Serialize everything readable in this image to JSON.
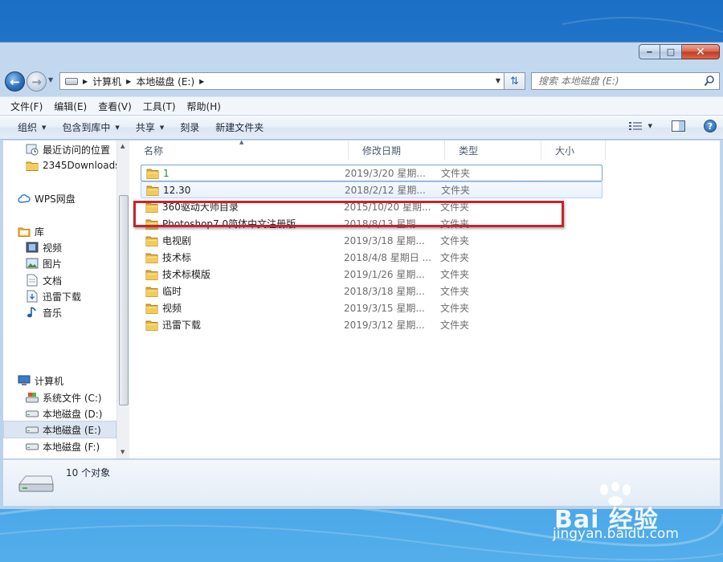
{
  "window": {
    "caption": {
      "minimize": "‒",
      "maximize": "□",
      "close": "✕"
    }
  },
  "address": {
    "crumbs": [
      "计算机",
      "本地磁盘 (E:)"
    ]
  },
  "search": {
    "placeholder": "搜索 本地磁盘 (E:)"
  },
  "menu": [
    "文件(F)",
    "编辑(E)",
    "查看(V)",
    "工具(T)",
    "帮助(H)"
  ],
  "toolbar": {
    "organize": "组织",
    "include_in_library": "包含到库中",
    "share": "共享",
    "burn": "刻录",
    "new_folder": "新建文件夹",
    "help": "?"
  },
  "nav": {
    "favorites": [
      {
        "label": "最近访问的位置",
        "icon": "recent-places-icon"
      },
      {
        "label": "2345Downloads",
        "icon": "folder-icon"
      }
    ],
    "wps": {
      "label": "WPS网盘",
      "icon": "cloud-icon"
    },
    "libraries": {
      "label": "库",
      "icon": "library-icon"
    },
    "library_items": [
      {
        "label": "视频",
        "icon": "video-icon"
      },
      {
        "label": "图片",
        "icon": "picture-icon"
      },
      {
        "label": "文档",
        "icon": "document-icon"
      },
      {
        "label": "迅雷下载",
        "icon": "download-icon"
      },
      {
        "label": "音乐",
        "icon": "music-icon"
      }
    ],
    "computer": {
      "label": "计算机",
      "icon": "computer-icon"
    },
    "drives": [
      {
        "label": "系统文件 (C:)",
        "icon": "system-drive-icon"
      },
      {
        "label": "本地磁盘 (D:)",
        "icon": "drive-icon"
      },
      {
        "label": "本地磁盘 (E:)",
        "icon": "drive-icon",
        "selected": true
      },
      {
        "label": "本地磁盘 (F:)",
        "icon": "drive-icon"
      }
    ]
  },
  "columns": {
    "name": "名称",
    "modified": "修改日期",
    "type": "类型",
    "size": "大小"
  },
  "files": [
    {
      "name": "1",
      "modified": "2019/3/20 星期...",
      "type": "文件夹",
      "state": "focused"
    },
    {
      "name": "12.30",
      "modified": "2018/2/12 星期...",
      "type": "文件夹",
      "state": "hover"
    },
    {
      "name": "360驱动大师目录",
      "modified": "2015/10/20 星期...",
      "type": "文件夹"
    },
    {
      "name": "Photoshop7.0简体中文注册版",
      "modified": "2018/8/13 星期...",
      "type": "文件夹"
    },
    {
      "name": "电视剧",
      "modified": "2019/3/18 星期...",
      "type": "文件夹"
    },
    {
      "name": "技术标",
      "modified": "2018/4/8 星期日 ...",
      "type": "文件夹"
    },
    {
      "name": "技术标模版",
      "modified": "2019/1/26 星期...",
      "type": "文件夹"
    },
    {
      "name": "临时",
      "modified": "2018/3/18 星期...",
      "type": "文件夹"
    },
    {
      "name": "视频",
      "modified": "2019/3/15 星期...",
      "type": "文件夹"
    },
    {
      "name": "迅雷下载",
      "modified": "2019/3/12 星期...",
      "type": "文件夹"
    }
  ],
  "details": {
    "count": "10 个对象"
  },
  "watermark": {
    "logo": "Bai 经验",
    "url": "jingyan.baidu.com"
  },
  "colors": {
    "annotation": "#c8232c",
    "desktop": "#2a86d8",
    "chrome": "#b9d1ea"
  }
}
